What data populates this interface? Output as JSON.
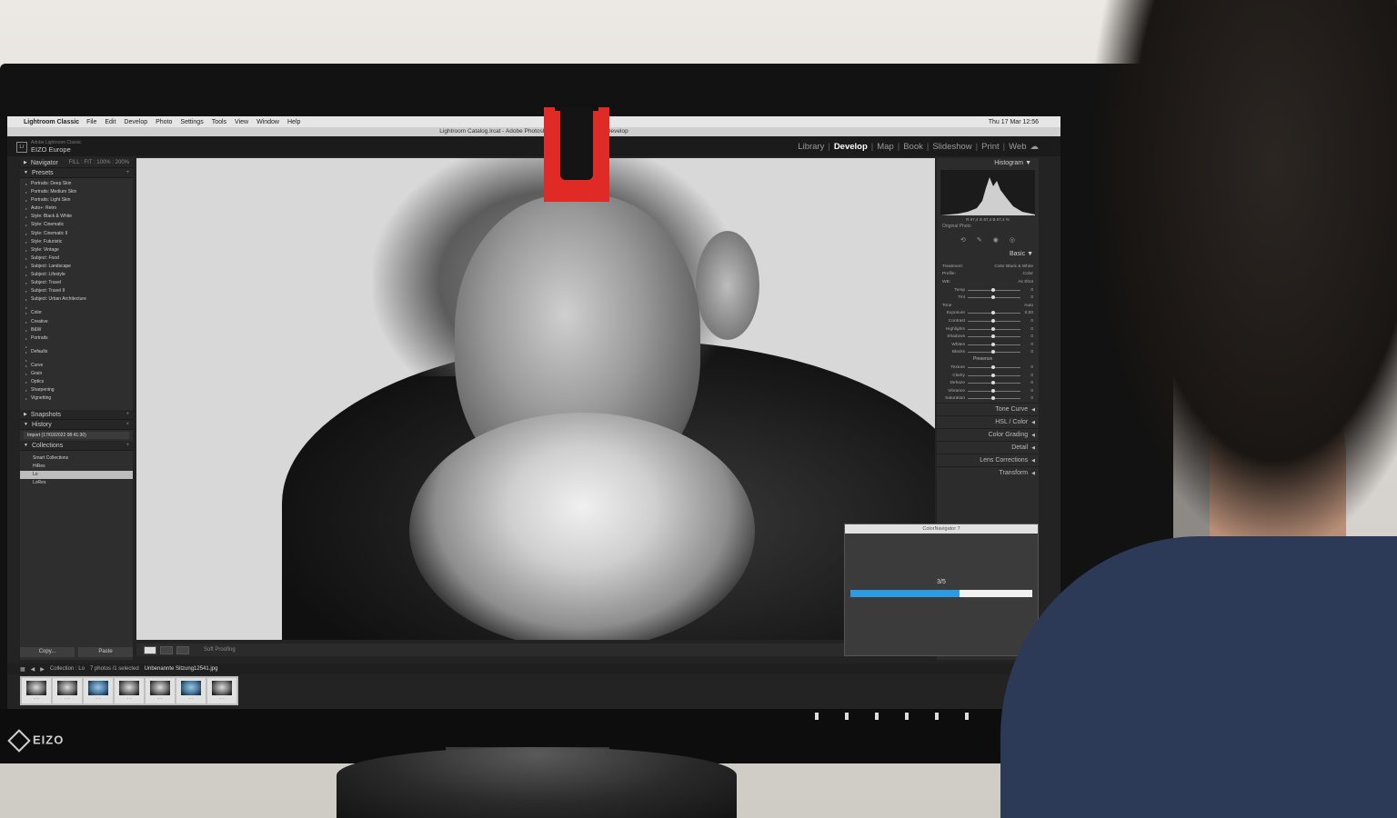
{
  "menubar": {
    "app_name": "Lightroom Classic",
    "items": [
      "File",
      "Edit",
      "Develop",
      "Photo",
      "Settings",
      "Tools",
      "View",
      "Window",
      "Help"
    ],
    "clock": "Thu 17 Mar  12:56"
  },
  "window_title": "Lightroom Catalog.lrcat - Adobe Photoshop Lightroom Classic - Develop",
  "identity_plate": {
    "subtitle": "Adobe Lightroom Classic",
    "name": "EIZO Europe"
  },
  "modules": [
    {
      "label": "Library",
      "active": false
    },
    {
      "label": "Develop",
      "active": true
    },
    {
      "label": "Map",
      "active": false
    },
    {
      "label": "Book",
      "active": false
    },
    {
      "label": "Slideshow",
      "active": false
    },
    {
      "label": "Print",
      "active": false
    },
    {
      "label": "Web",
      "active": false
    }
  ],
  "left_panel": {
    "navigator": {
      "title": "Navigator",
      "zoom": "FILL : FIT : 100% : 200%"
    },
    "presets": {
      "title": "Presets",
      "items": [
        "Portraits: Deep Skin",
        "Portraits: Medium Skin",
        "Portraits: Light Skin",
        "Auto+: Retro",
        "Style: Black & White",
        "Style: Cinematic",
        "Style: Cinematic II",
        "Style: Futuristic",
        "Style: Vintage",
        "Subject: Food",
        "Subject: Landscape",
        "Subject: Lifestyle",
        "Subject: Travel",
        "Subject: Travel II",
        "Subject: Urban Architecture",
        "Color",
        "Creative",
        "B&W",
        "Portraits",
        "Defaults",
        "Curve",
        "Grain",
        "Optics",
        "Sharpening",
        "Vignetting"
      ]
    },
    "snapshots_title": "Snapshots",
    "history": {
      "title": "History",
      "item": "Import (17/03/2022 08:41:30)"
    },
    "collections": {
      "title": "Collections",
      "items": [
        {
          "label": "Smart Collections",
          "count": "",
          "selected": false
        },
        {
          "label": "HiRes",
          "count": "7",
          "selected": false
        },
        {
          "label": "Lo",
          "count": "7",
          "selected": true
        },
        {
          "label": "LoRes",
          "count": "7",
          "selected": false
        }
      ]
    },
    "copy_label": "Copy...",
    "paste_label": "Paste"
  },
  "toolbar": {
    "soft_proofing": "Soft Proofing"
  },
  "right_panel": {
    "histogram_title": "Histogram",
    "histogram_values": "R 67,4   G 67,4   B 67,4 %",
    "original_photo": "Original Photo",
    "basic_title": "Basic",
    "treatment": {
      "label": "Treatment:",
      "options": "Color   Black & White"
    },
    "profile": {
      "label": "Profile:",
      "value": "Color"
    },
    "wb": {
      "label": "WB:",
      "value": "As Shot"
    },
    "wb_sliders": [
      {
        "label": "Temp",
        "value": "0"
      },
      {
        "label": "Tint",
        "value": "0"
      }
    ],
    "tone_title": "Tone",
    "tone_auto": "Auto",
    "tone_sliders": [
      {
        "label": "Exposure",
        "value": "0,00"
      },
      {
        "label": "Contrast",
        "value": "0"
      },
      {
        "label": "Highlights",
        "value": "0"
      },
      {
        "label": "Shadows",
        "value": "0"
      },
      {
        "label": "Whites",
        "value": "0"
      },
      {
        "label": "Blacks",
        "value": "0"
      }
    ],
    "presence_title": "Presence",
    "presence_sliders": [
      {
        "label": "Texture",
        "value": "0"
      },
      {
        "label": "Clarity",
        "value": "0"
      },
      {
        "label": "Dehaze",
        "value": "0"
      },
      {
        "label": "Vibrance",
        "value": "0"
      },
      {
        "label": "Saturation",
        "value": "0"
      }
    ],
    "collapsed_panels": [
      "Tone Curve",
      "HSL / Color",
      "Color Grading",
      "Detail",
      "Lens Corrections",
      "Transform"
    ]
  },
  "dialog": {
    "title": "ColorNavigator 7",
    "count": "3/5",
    "progress_fraction": 0.6
  },
  "filmstrip": {
    "collection": "Collection : Lo",
    "selection": "7 photos /1 selected",
    "filename": "Unbenannte Sitzung12541.jpg",
    "thumbnail_count": 7
  },
  "monitor_brand": "EIZO",
  "colors": {
    "accent": "#2b9be3",
    "clip": "#e02a25"
  }
}
